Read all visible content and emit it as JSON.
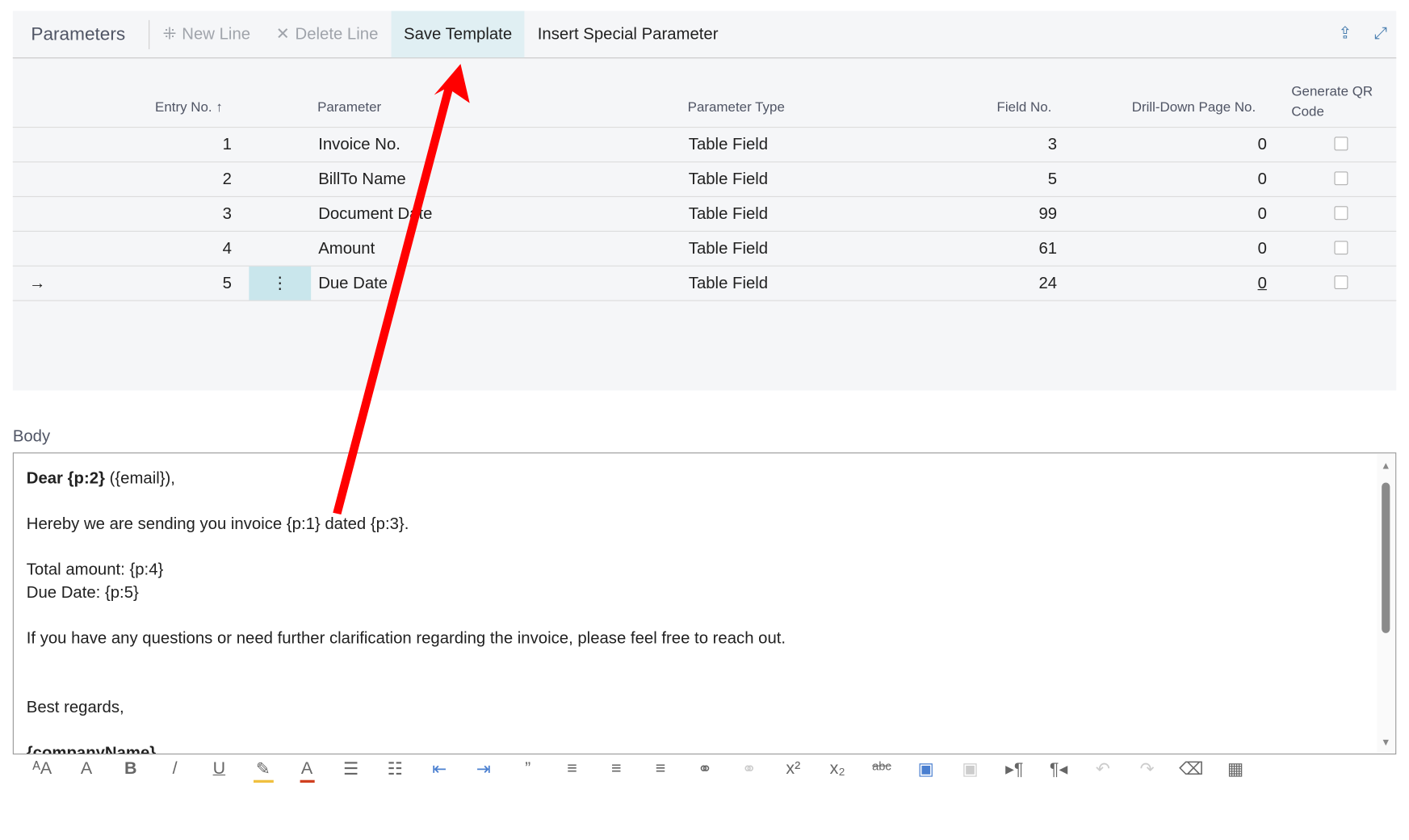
{
  "toolbar": {
    "title": "Parameters",
    "new_line": "New Line",
    "delete_line": "Delete Line",
    "save_template": "Save Template",
    "insert_special": "Insert Special Parameter"
  },
  "table": {
    "headers": {
      "entry_no": "Entry No.",
      "parameter": "Parameter",
      "parameter_type": "Parameter Type",
      "field_no": "Field No.",
      "drill_down": "Drill-Down Page No.",
      "generate_qr": "Generate QR Code"
    },
    "rows": [
      {
        "entry": "1",
        "parameter": "Invoice No.",
        "type": "Table Field",
        "field": "3",
        "drill": "0",
        "qr": false
      },
      {
        "entry": "2",
        "parameter": "BillTo Name",
        "type": "Table Field",
        "field": "5",
        "drill": "0",
        "qr": false
      },
      {
        "entry": "3",
        "parameter": "Document Date",
        "type": "Table Field",
        "field": "99",
        "drill": "0",
        "qr": false
      },
      {
        "entry": "4",
        "parameter": "Amount",
        "type": "Table Field",
        "field": "61",
        "drill": "0",
        "qr": false
      },
      {
        "entry": "5",
        "parameter": "Due Date",
        "type": "Table Field",
        "field": "24",
        "drill": "0",
        "qr": false
      }
    ]
  },
  "body": {
    "label": "Body",
    "greeting_bold": "Dear {p:2}",
    "greeting_rest": " ({email}),",
    "line1": "Hereby we are sending you invoice {p:1} dated {p:3}.",
    "line2": "Total amount: {p:4}",
    "line3": "Due Date: {p:5}",
    "line4": "If you have any questions or need further clarification regarding the invoice, please feel free to reach out.",
    "line5": "Best regards,",
    "line6": "{companyName}"
  },
  "annotation": {
    "arrow_color": "#ff0000"
  }
}
